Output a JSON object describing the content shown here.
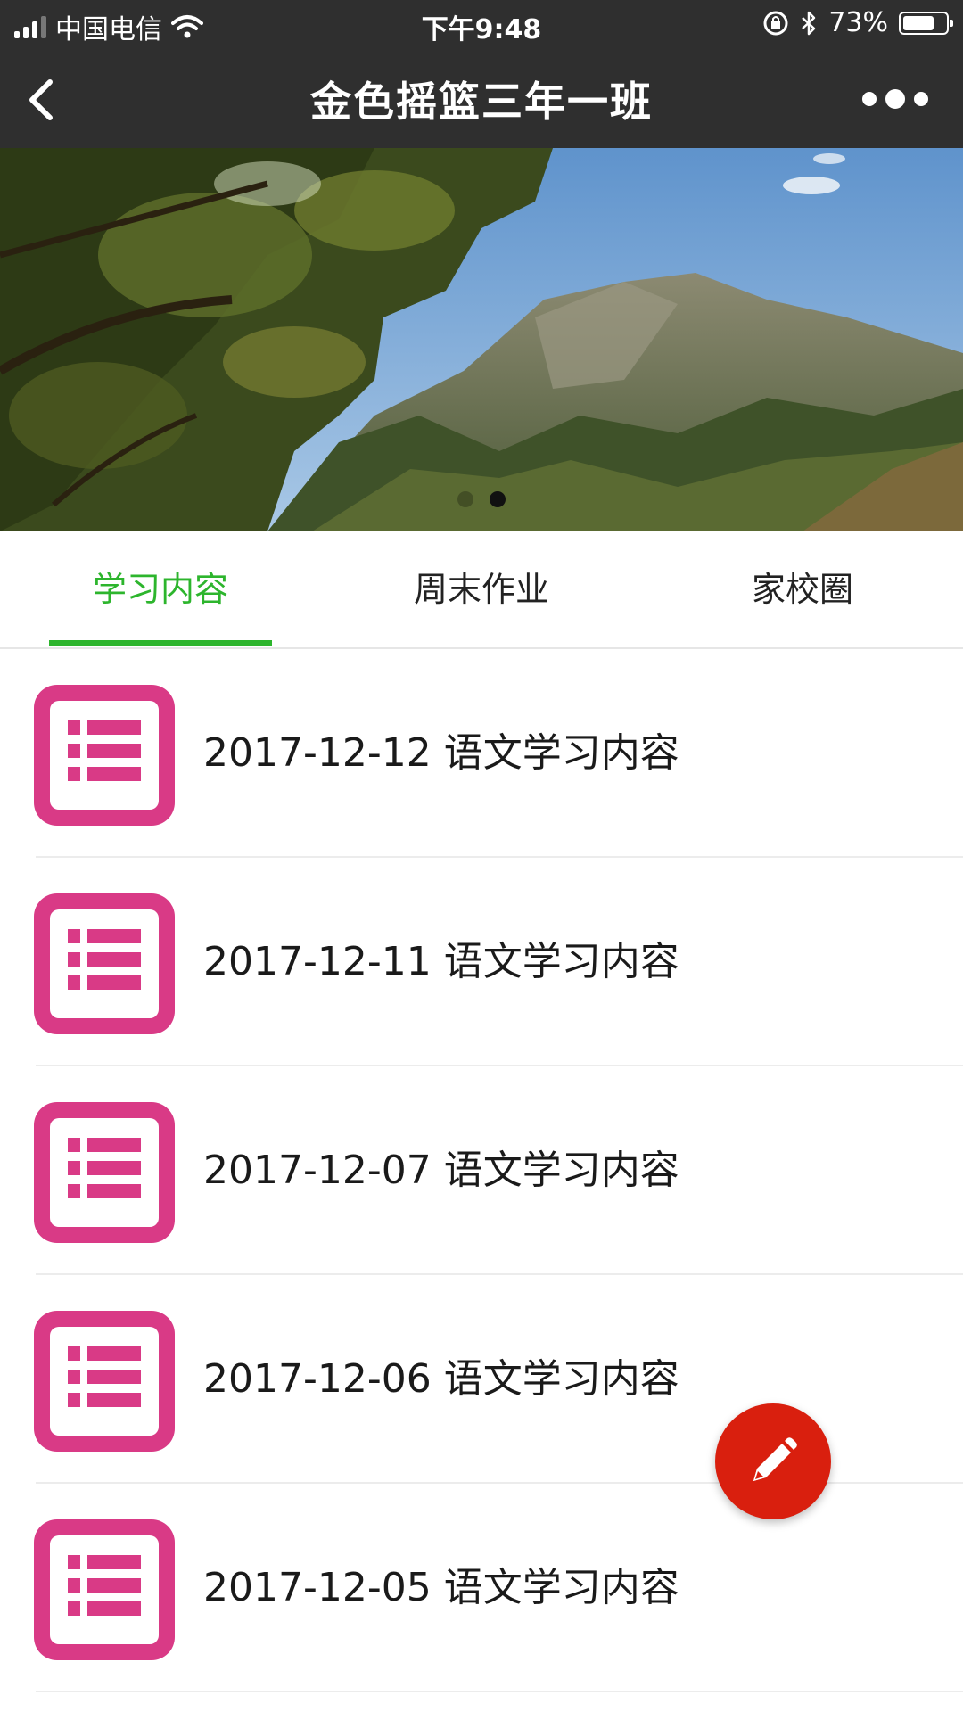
{
  "status_bar": {
    "carrier": "中国电信",
    "time": "下午9:48",
    "battery_percent": "73%",
    "battery_level": 0.73,
    "icons": [
      "signal-icon",
      "wifi-icon",
      "lock-rotation-icon",
      "bluetooth-icon",
      "battery-icon"
    ]
  },
  "nav": {
    "title": "金色摇篮三年一班",
    "back_icon": "chevron-left-icon",
    "more_icon": "more-dots-icon"
  },
  "banner": {
    "carousel_page_count": 2,
    "carousel_active_index": 1
  },
  "tabs": [
    {
      "label": "学习内容",
      "active": true
    },
    {
      "label": "周末作业",
      "active": false
    },
    {
      "label": "家校圈",
      "active": false
    }
  ],
  "list": {
    "item_icon": "list-document-icon",
    "items": [
      {
        "title": "2017-12-12 语文学习内容"
      },
      {
        "title": "2017-12-11 语文学习内容"
      },
      {
        "title": "2017-12-07 语文学习内容"
      },
      {
        "title": "2017-12-06 语文学习内容"
      },
      {
        "title": "2017-12-05 语文学习内容"
      }
    ]
  },
  "fab": {
    "icon": "pencil-icon"
  },
  "colors": {
    "bar_background": "#2f2f2f",
    "accent_green": "#2db52d",
    "icon_pink": "#d93a86",
    "fab_red": "#d91f0e"
  }
}
